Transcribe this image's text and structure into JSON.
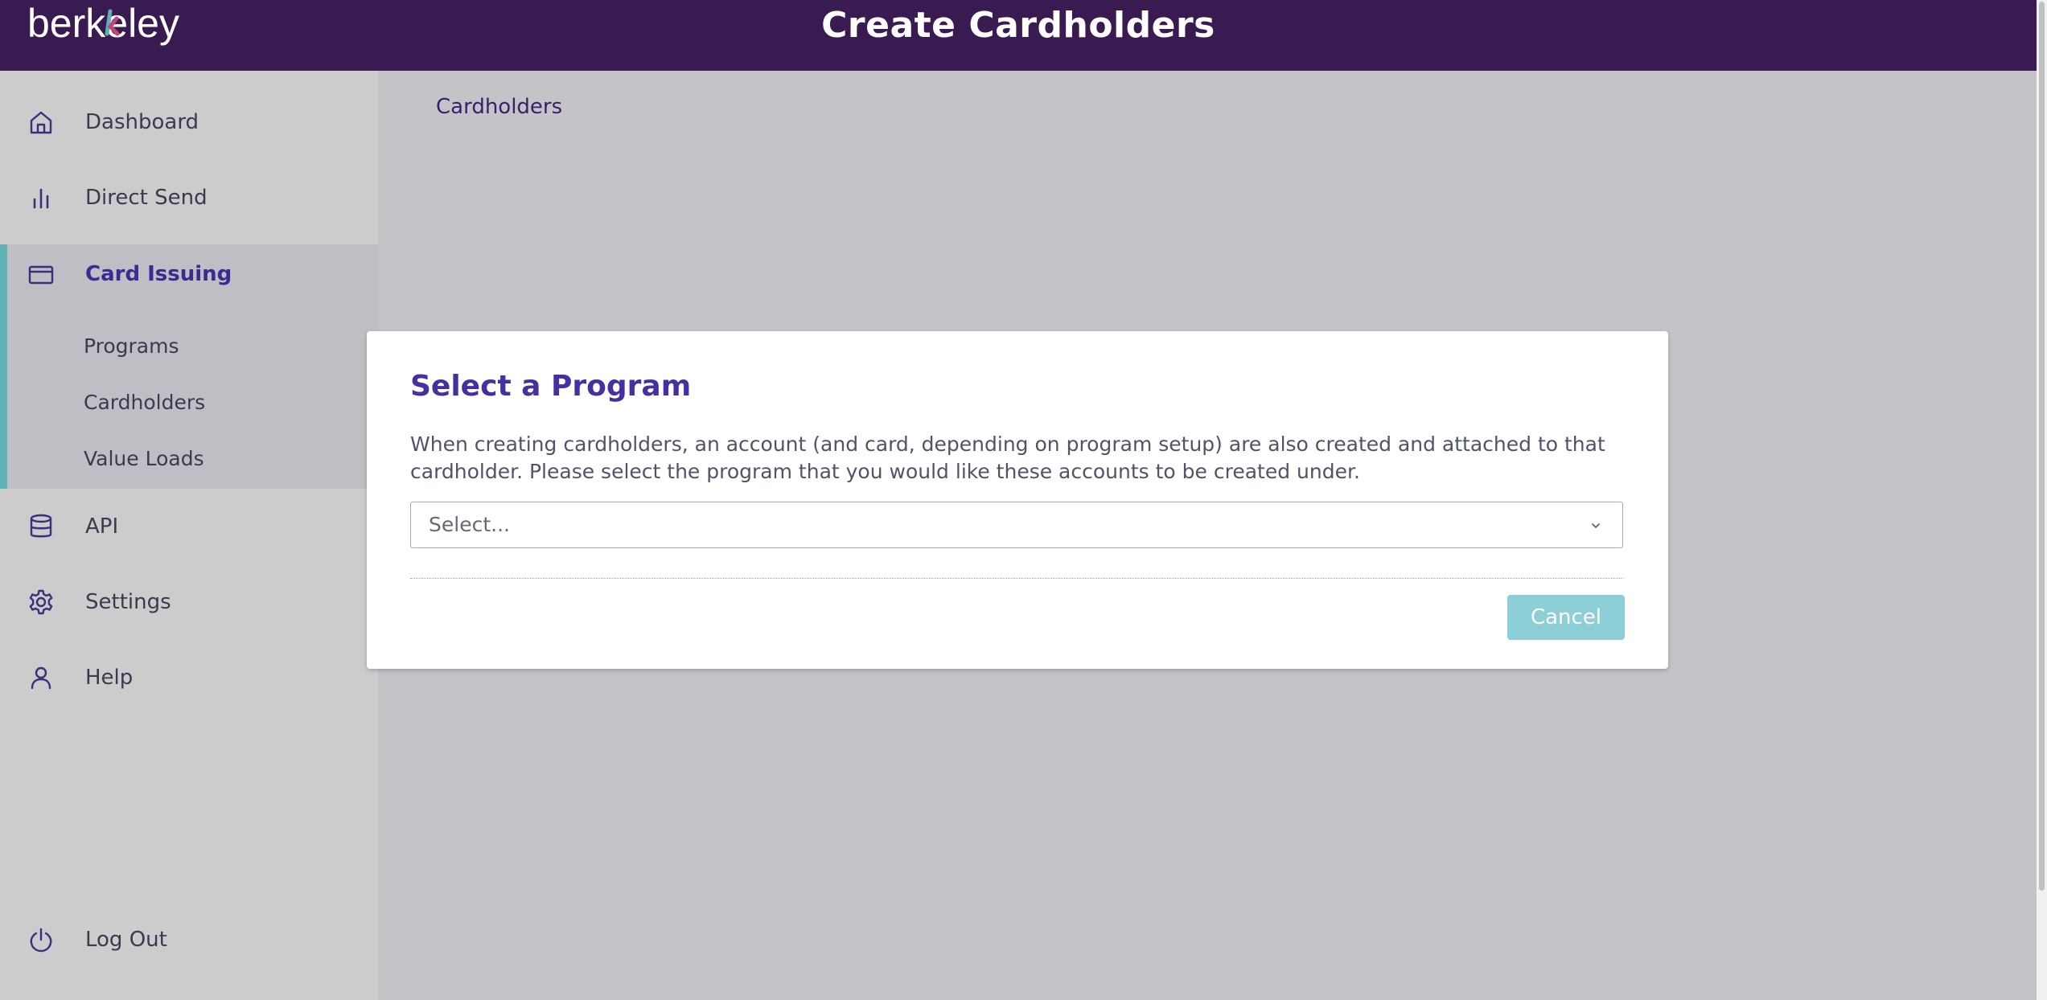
{
  "header": {
    "logo_text": "berkeley",
    "title": "Create Cardholders"
  },
  "sidebar": {
    "items": [
      {
        "label": "Dashboard",
        "icon": "home-icon"
      },
      {
        "label": "Direct Send",
        "icon": "bar-chart-icon"
      },
      {
        "label": "Card Issuing",
        "icon": "credit-card-icon",
        "active": true
      },
      {
        "label": "API",
        "icon": "database-icon"
      },
      {
        "label": "Settings",
        "icon": "gear-icon"
      },
      {
        "label": "Help",
        "icon": "user-icon"
      }
    ],
    "card_issuing_subitems": [
      "Programs",
      "Cardholders",
      "Value Loads"
    ],
    "logout_label": "Log Out"
  },
  "breadcrumb": "Cardholders",
  "modal": {
    "title": "Select a Program",
    "description": "When creating cardholders, an account (and card, depending on program setup) are also created and attached to that cardholder. Please select the program that you would like these accounts to be created under.",
    "select_placeholder": "Select...",
    "cancel_label": "Cancel"
  },
  "colors": {
    "header_bg": "#3a1b51",
    "sidebar_bg": "#cccccc",
    "active_accent": "#5fb1b5",
    "active_text": "#3b2a8f",
    "modal_title": "#4530a2",
    "cancel_button_bg": "#8ccfd6"
  }
}
